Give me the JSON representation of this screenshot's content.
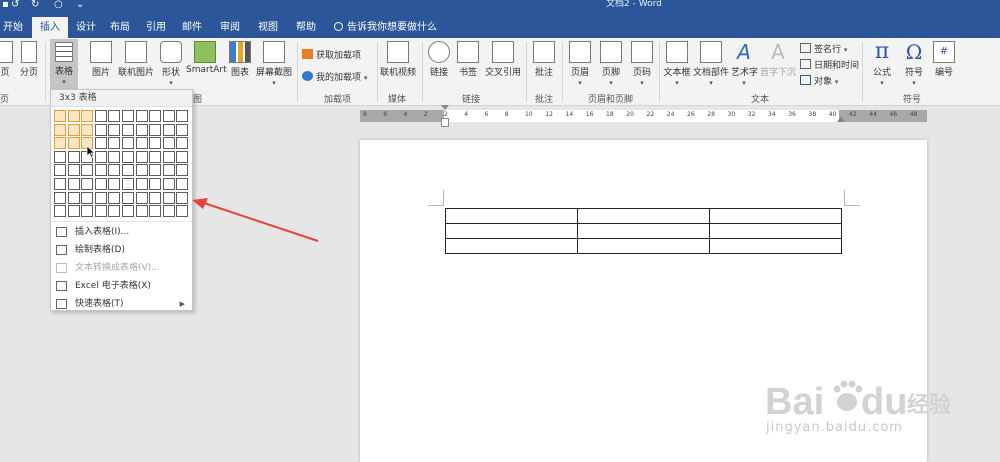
{
  "titlebar": {
    "title": "文档2 - Word",
    "qat_icons": [
      "word-logo-icon",
      "undo-icon",
      "redo-icon",
      "customize-qat-icon"
    ]
  },
  "tabs": [
    {
      "label": "开始",
      "active": false
    },
    {
      "label": "插入",
      "active": true
    },
    {
      "label": "设计",
      "active": false
    },
    {
      "label": "布局",
      "active": false
    },
    {
      "label": "引用",
      "active": false
    },
    {
      "label": "邮件",
      "active": false
    },
    {
      "label": "审阅",
      "active": false
    },
    {
      "label": "视图",
      "active": false
    },
    {
      "label": "帮助",
      "active": false
    }
  ],
  "tell_me": "告诉我你想要做什么",
  "ribbon": {
    "pages": {
      "cover_page": "页",
      "blank_page": "分页"
    },
    "tables": {
      "table": "表格"
    },
    "illustrations": {
      "pictures": "图片",
      "online_pictures": "联机图片",
      "shapes": "形状",
      "smartart": "SmartArt",
      "chart": "图表",
      "screenshot": "屏幕截图"
    },
    "addins": {
      "get_addins": "获取加载项",
      "my_addins": "我的加载项"
    },
    "media": {
      "online_video": "联机视频"
    },
    "links": {
      "link": "链接",
      "bookmark": "书签",
      "cross_ref": "交叉引用"
    },
    "comments": {
      "comment": "批注"
    },
    "header_footer": {
      "header": "页眉",
      "footer": "页脚",
      "page_number": "页码"
    },
    "text": {
      "text_box": "文本框",
      "quick_parts": "文档部件",
      "wordart": "艺术字",
      "drop_cap": "首字下沉",
      "signature_line": "签名行",
      "date_time": "日期和时间",
      "object": "对象"
    },
    "symbols": {
      "equation": "公式",
      "symbol": "符号",
      "number": "编号"
    },
    "group_labels": {
      "pages": "页",
      "illustrations": "图",
      "addins": "加载项",
      "media": "媒体",
      "links": "链接",
      "comments": "批注",
      "header_footer": "页眉和页脚",
      "text": "文本",
      "symbols": "符号"
    }
  },
  "ruler": {
    "ticks": [
      "8",
      "6",
      "4",
      "2",
      "2",
      "4",
      "6",
      "8",
      "10",
      "12",
      "14",
      "16",
      "18",
      "20",
      "22",
      "24",
      "26",
      "28",
      "30",
      "32",
      "34",
      "36",
      "38",
      "40",
      "42",
      "44",
      "46",
      "48"
    ]
  },
  "table_dropdown": {
    "header": "3x3 表格",
    "grid_cols": 10,
    "grid_rows": 8,
    "selected_cols": 3,
    "selected_rows": 3,
    "items": [
      {
        "label": "插入表格(I)...",
        "icon": "insert-table-icon",
        "disabled": false,
        "submenu": false
      },
      {
        "label": "绘制表格(D)",
        "icon": "draw-table-icon",
        "disabled": false,
        "submenu": false
      },
      {
        "label": "文本转换成表格(V)...",
        "icon": "text-to-table-icon",
        "disabled": true,
        "submenu": false
      },
      {
        "label": "Excel 电子表格(X)",
        "icon": "excel-icon",
        "disabled": false,
        "submenu": false
      },
      {
        "label": "快速表格(T)",
        "icon": "quick-tables-icon",
        "disabled": false,
        "submenu": true
      }
    ]
  },
  "document": {
    "table_rows": 3,
    "table_cols": 3
  },
  "watermark": {
    "brand": "Bai",
    "brand2": "du",
    "cn": "经验",
    "site": "jingyan.baidu.com"
  },
  "colors": {
    "accent": "#2b579a",
    "grid_highlight": "#e59b3c",
    "arrow": "#e8413c"
  }
}
